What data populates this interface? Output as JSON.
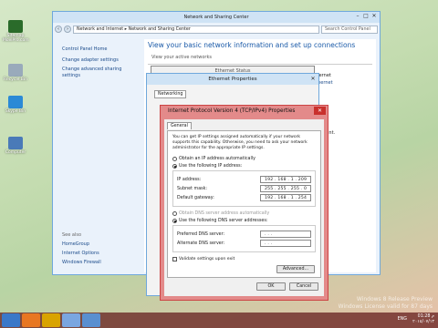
{
  "desktop": {
    "icons": [
      {
        "label": "Sitemap\nMoviPro.com"
      },
      {
        "label": "Recycle\nBin"
      },
      {
        "label": "Skype\nBin"
      },
      {
        "label": "Computer"
      }
    ]
  },
  "nsc": {
    "title": "Network and Sharing Center",
    "address": "Network and Internet  ▸  Network and Sharing Center",
    "search_placeholder": "Search Control Panel",
    "left_links": [
      "Control Panel Home",
      "Change adapter settings",
      "Change advanced sharing settings"
    ],
    "see_also": "See also",
    "see_also_links": [
      "HomeGroup",
      "Internet Options",
      "Windows Firewall"
    ],
    "heading": "View your basic network information and set up connections",
    "active_networks": "View your active networks",
    "right_labels": [
      "Internet",
      "Ethernet"
    ],
    "right_note": "ss point."
  },
  "eth_status": {
    "title": "Ethernet Status"
  },
  "eth_props": {
    "title": "Ethernet Properties",
    "tab": "Networking"
  },
  "ipv4": {
    "title": "Internet Protocol Version 4 (TCP/IPv4) Properties",
    "tab": "General",
    "desc": "You can get IP settings assigned automatically if your network supports this capability. Otherwise, you need to ask your network administrator for the appropriate IP settings.",
    "auto_ip": "Obtain an IP address automatically",
    "use_ip": "Use the following IP address:",
    "ip_label": "IP address:",
    "ip_value": "192 . 168 .  1  . 209",
    "mask_label": "Subnet mask:",
    "mask_value": "255 . 255 . 255 .  0",
    "gw_label": "Default gateway:",
    "gw_value": "192 . 168 .  1  . 254",
    "auto_dns": "Obtain DNS server address automatically",
    "use_dns": "Use the following DNS server addresses:",
    "pref_dns": "Preferred DNS server:",
    "pref_dns_value": " .    .    . ",
    "alt_dns": "Alternate DNS server:",
    "alt_dns_value": " .    .    . ",
    "validate": "Validate settings upon exit",
    "advanced": "Advanced...",
    "ok": "OK",
    "cancel": "Cancel"
  },
  "taskbar": {
    "lang": "ENG",
    "time": "01:28 م",
    "date": "٢٠١٥/٠٧/١٣",
    "wm1": "Windows 8 Release Preview",
    "wm2": "Windows License valid for 87 days"
  },
  "colors": {
    "accent": "#c44",
    "link": "#1a4a8a"
  }
}
